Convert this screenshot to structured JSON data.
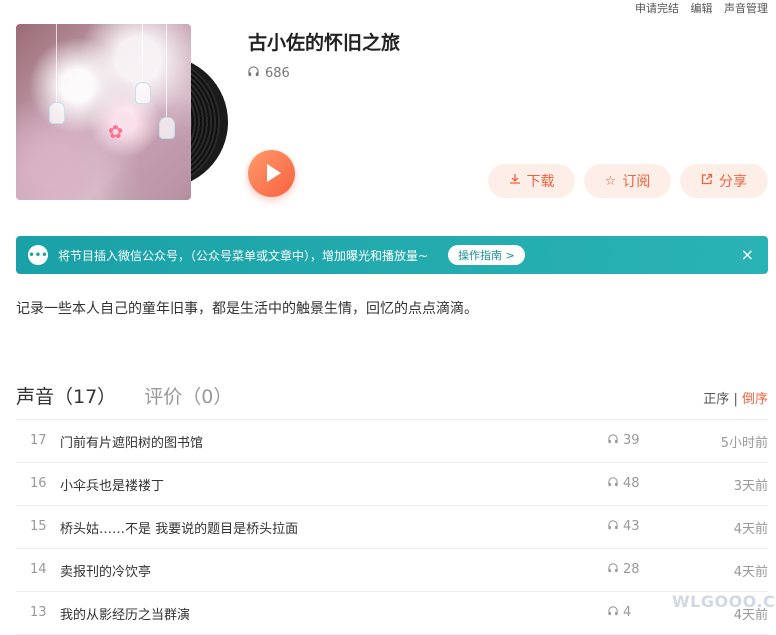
{
  "top_links": [
    "申请完结",
    "编辑",
    "声音管理"
  ],
  "album": {
    "title": "古小佐的怀旧之旅",
    "play_count": "686",
    "description": "记录一些本人自己的童年旧事，都是生活中的触景生情，回忆的点点滴滴。"
  },
  "actions": {
    "download": "下载",
    "subscribe": "订阅",
    "share": "分享"
  },
  "banner": {
    "text": "将节目插入微信公众号，（公众号菜单或文章中），增加曝光和播放量~",
    "guide": "操作指南 >",
    "close": "×"
  },
  "tabs": {
    "sounds": "声音（17）",
    "reviews": "评价（0）"
  },
  "sort": {
    "asc": "正序",
    "separator": "|",
    "desc": "倒序"
  },
  "tracks": [
    {
      "num": "17",
      "title": "门前有片遮阳树的图书馆",
      "plays": "39",
      "time": "5小时前"
    },
    {
      "num": "16",
      "title": "小伞兵也是褛褛丁",
      "plays": "48",
      "time": "3天前"
    },
    {
      "num": "15",
      "title": "桥头姑……不是 我要说的题目是桥头拉面",
      "plays": "43",
      "time": "4天前"
    },
    {
      "num": "14",
      "title": "卖报刊的冷饮亭",
      "plays": "28",
      "time": "4天前"
    },
    {
      "num": "13",
      "title": "我的从影经历之当群演",
      "plays": "4",
      "time": "4天前"
    }
  ],
  "watermark": "WLGOOO.COM",
  "colors": {
    "accent": "#f0623f",
    "banner": "#1aa1a7"
  }
}
